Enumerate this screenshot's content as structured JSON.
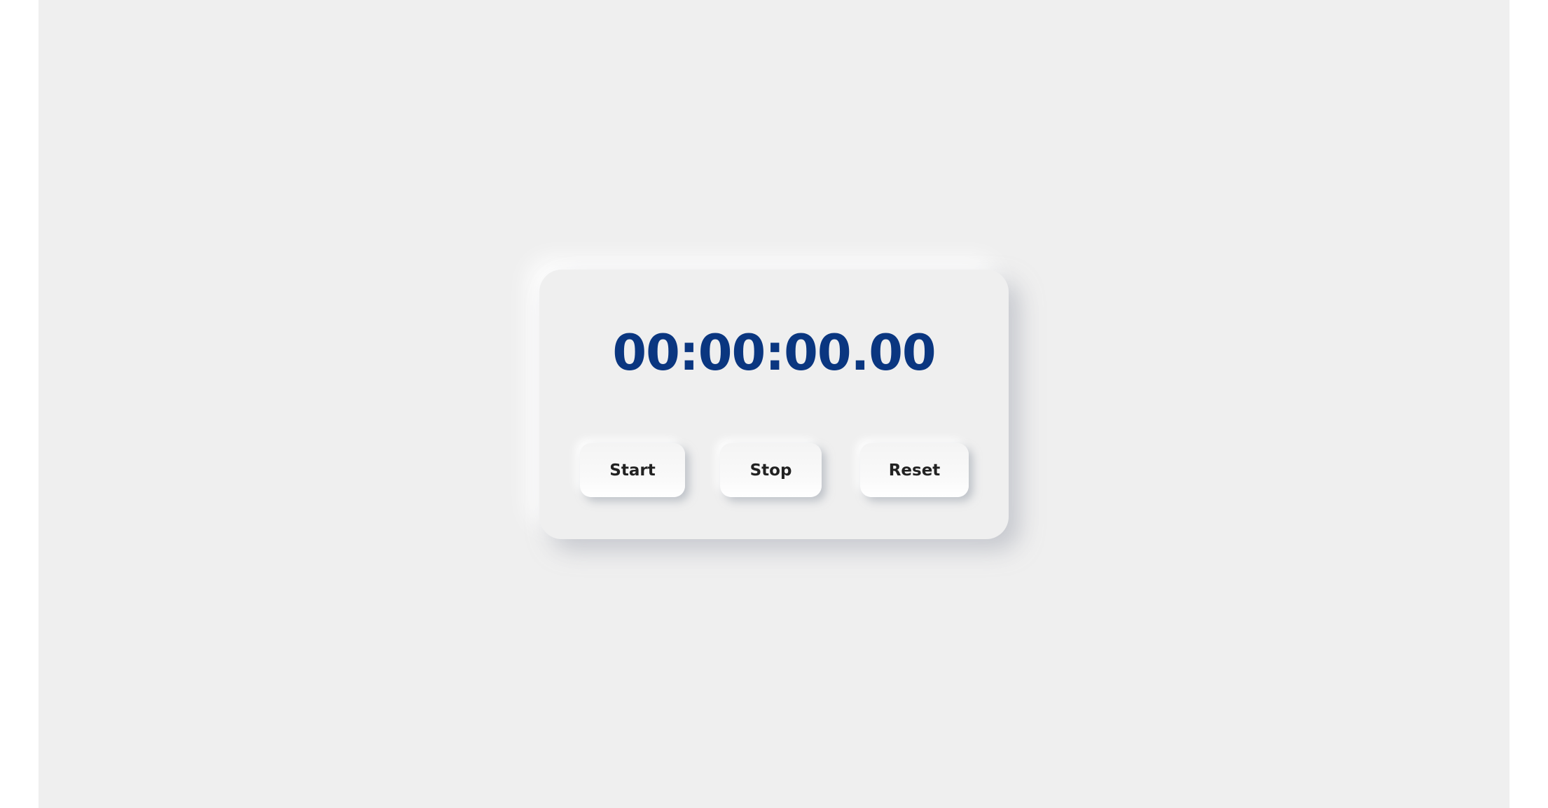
{
  "stopwatch": {
    "time_display": "00:00:00.00",
    "start_label": "Start",
    "stop_label": "Stop",
    "reset_label": "Reset"
  },
  "colors": {
    "background": "#efefef",
    "time_text": "#0a3680",
    "button_text": "#222222"
  }
}
